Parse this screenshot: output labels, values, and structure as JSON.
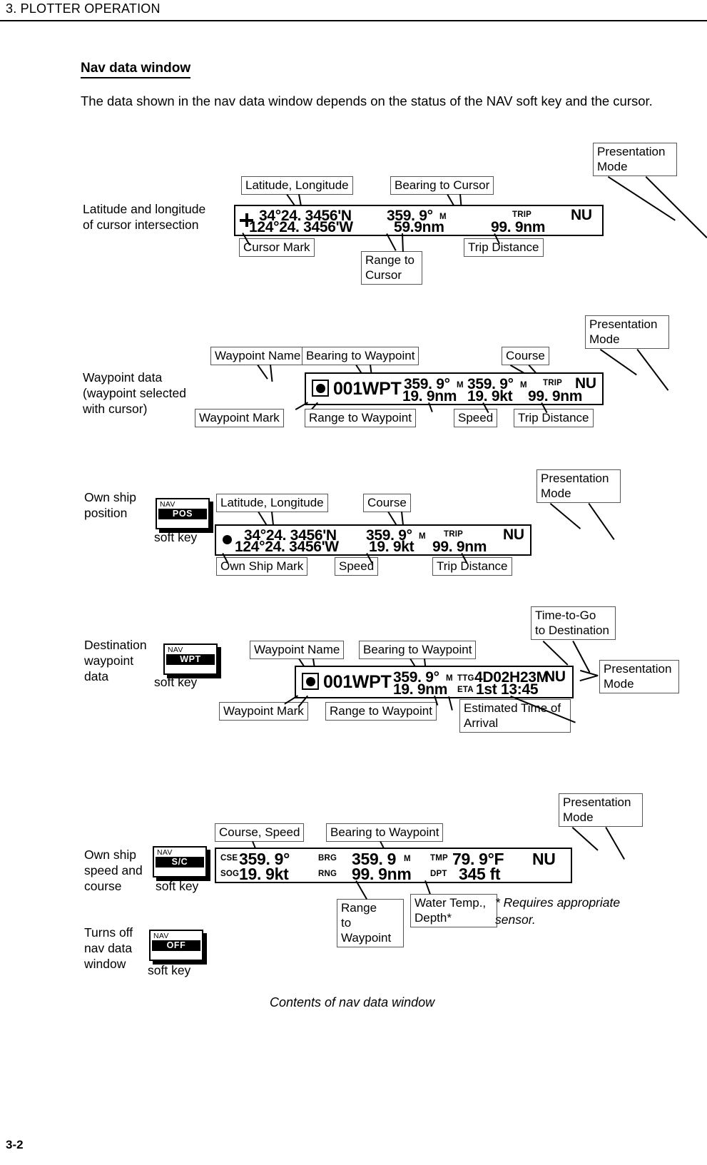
{
  "page": {
    "chapter_header": "3. PLOTTER OPERATION",
    "page_number": "3-2",
    "section_heading": "Nav data window",
    "intro_paragraph": "The data shown in the nav data window depends on the status of the NAV soft key and the cursor.",
    "figure_caption": "Contents of nav data window",
    "footnote": "* Requires appropriate sensor."
  },
  "common": {
    "softkey_caption": "soft key",
    "softkey_top": "NAV",
    "presentation_mode": "Presentation Mode",
    "presentation_mode_l1": "Presentation",
    "presentation_mode_l2": "Mode",
    "trip_label": "TRIP",
    "mode_value": "NU",
    "deg_m": "M"
  },
  "sections": [
    {
      "id": "cursor",
      "side_label_l1": "Latitude and longitude",
      "side_label_l2": "of cursor intersection",
      "display": {
        "cursor_mark_icon": "cursor-cross-mark",
        "latitude": "34°24. 3456'N",
        "longitude": "124°24. 3456'W",
        "bearing": "359. 9°",
        "bearing_unit": "M",
        "range": "59.9nm",
        "trip_label": "TRIP",
        "trip_distance": "99. 9nm",
        "mode": "NU"
      },
      "callouts": {
        "lat_lon": "Latitude, Longitude",
        "bearing": "Bearing to Cursor",
        "presentation_mode": "Presentation Mode",
        "cursor_mark": "Cursor Mark",
        "range": "Range to Cursor",
        "trip": "Trip Distance"
      }
    },
    {
      "id": "waypoint",
      "side_label_l1": "Waypoint data",
      "side_label_l2": "(waypoint selected",
      "side_label_l3": "with cursor)",
      "display": {
        "waypoint_mark_icon": "waypoint-circle-in-square-mark",
        "waypoint_name": "001WPT",
        "bearing": "359. 9°",
        "bearing_unit": "M",
        "course": "359. 9°",
        "course_unit": "M",
        "trip_label": "TRIP",
        "mode": "NU",
        "range": "19. 9nm",
        "speed": "19. 9kt",
        "trip_distance": "99. 9nm"
      },
      "callouts": {
        "waypoint_name": "Waypoint Name",
        "bearing": "Bearing to Waypoint",
        "course": "Course",
        "presentation_mode": "Presentation Mode",
        "waypoint_mark": "Waypoint Mark",
        "range": "Range to Waypoint",
        "speed": "Speed",
        "trip": "Trip Distance"
      }
    },
    {
      "id": "own-ship-position",
      "side_label_l1": "Own ship",
      "side_label_l2": "position",
      "softkey_label": "POS",
      "display": {
        "ship_mark_icon": "own-ship-dot-mark",
        "latitude": "34°24. 3456'N",
        "longitude": "124°24. 3456'W",
        "course": "359. 9°",
        "course_unit": "M",
        "trip_label": "TRIP",
        "mode": "NU",
        "speed": "19. 9kt",
        "trip_distance": "99. 9nm"
      },
      "callouts": {
        "lat_lon": "Latitude, Longitude",
        "course": "Course",
        "presentation_mode": "Presentation Mode",
        "ship_mark": "Own Ship Mark",
        "speed": "Speed",
        "trip": "Trip Distance"
      }
    },
    {
      "id": "destination-waypoint",
      "side_label_l1": "Destination",
      "side_label_l2": "waypoint",
      "side_label_l3": "data",
      "softkey_label": "WPT",
      "display": {
        "waypoint_mark_icon": "waypoint-circle-in-square-mark",
        "waypoint_name": "001WPT",
        "bearing": "359. 9°",
        "bearing_unit": "M",
        "ttg_label": "TTG",
        "ttg_value": "4D02H23M",
        "mode": "NU",
        "range": "19. 9nm",
        "eta_label": "ETA",
        "eta_value": "1st 13:45"
      },
      "callouts": {
        "waypoint_name": "Waypoint Name",
        "bearing": "Bearing to Waypoint",
        "ttg_l1": "Time-to-Go",
        "ttg_l2": "to Destination",
        "presentation_mode": "Presentation Mode",
        "waypoint_mark": "Waypoint Mark",
        "range": "Range to Waypoint",
        "eta_l1": "Estimated Time of",
        "eta_l2": "Arrival"
      }
    },
    {
      "id": "speed-course",
      "side_label_l1": "Own ship",
      "side_label_l2": "speed and",
      "side_label_l3": "course",
      "softkey_label": "S/C",
      "display": {
        "cse_label": "CSE",
        "cse_value": "359. 9°",
        "sog_label": "SOG",
        "sog_value": "19. 9kt",
        "brg_label": "BRG",
        "brg_value": "359. 9",
        "brg_unit": "M",
        "rng_label": "RNG",
        "rng_value": "99. 9nm",
        "tmp_label": "TMP",
        "tmp_value": "79. 9°F",
        "dpt_label": "DPT",
        "dpt_value": "345 ft",
        "mode": "NU"
      },
      "callouts": {
        "course_speed": "Course, Speed",
        "bearing": "Bearing to Waypoint",
        "presentation_mode": "Presentation Mode",
        "range_l1": "Range",
        "range_l2": "to",
        "range_l3": "Waypoint",
        "water_l1": "Water Temp.,",
        "water_l2": "Depth*"
      }
    },
    {
      "id": "nav-off",
      "side_label_l1": "Turns off",
      "side_label_l2": "nav data",
      "side_label_l3": "window",
      "softkey_label": "OFF"
    }
  ]
}
